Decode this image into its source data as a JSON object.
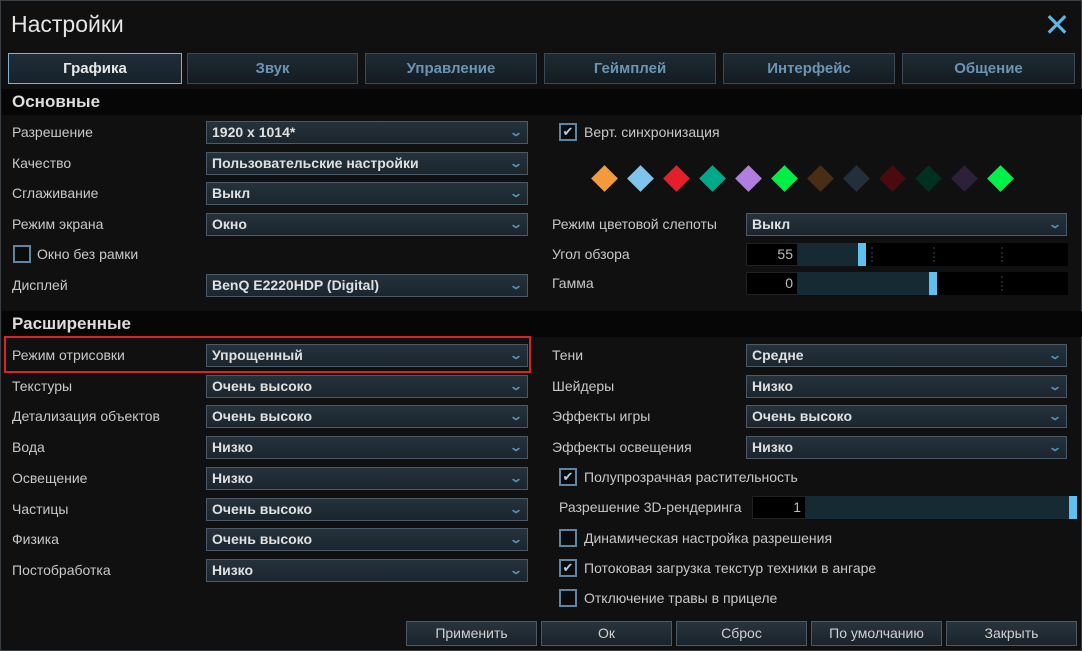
{
  "title": "Настройки",
  "tabs": [
    "Графика",
    "Звук",
    "Управление",
    "Геймплей",
    "Интерфейс",
    "Общение"
  ],
  "basic": {
    "header": "Основные",
    "resolution": {
      "label": "Разрешение",
      "value": "1920 x 1014*"
    },
    "quality": {
      "label": "Качество",
      "value": "Пользовательские настройки"
    },
    "aa": {
      "label": "Сглаживание",
      "value": "Выкл"
    },
    "screen_mode": {
      "label": "Режим экрана",
      "value": "Окно"
    },
    "borderless": {
      "label": "Окно без рамки",
      "checked": false
    },
    "display": {
      "label": "Дисплей",
      "value": "BenQ E2220HDP (Digital)"
    },
    "vsync": {
      "label": "Верт. синхронизация",
      "checked": true
    },
    "colors": [
      "#f39a3c",
      "#7fc4ec",
      "#e51f2a",
      "#00a98a",
      "#b07ee0",
      "#00ee45",
      "#4a2d15",
      "#22303b",
      "#4a0b0e",
      "#00301f",
      "#2d2038",
      "#00f04a"
    ],
    "colorblind": {
      "label": "Режим цветовой слепоты",
      "value": "Выкл"
    },
    "fov": {
      "label": "Угол обзора",
      "value": "55",
      "fraction": 0.23
    },
    "gamma": {
      "label": "Гамма",
      "value": "0",
      "fraction": 0.5
    }
  },
  "advanced": {
    "header": "Расширенные",
    "left": [
      {
        "label": "Режим отрисовки",
        "value": "Упрощенный"
      },
      {
        "label": "Текстуры",
        "value": "Очень высоко"
      },
      {
        "label": "Детализация объектов",
        "value": "Очень высоко"
      },
      {
        "label": "Вода",
        "value": "Низко"
      },
      {
        "label": "Освещение",
        "value": "Низко"
      },
      {
        "label": "Частицы",
        "value": "Очень высоко"
      },
      {
        "label": "Физика",
        "value": "Очень высоко"
      },
      {
        "label": "Постобработка",
        "value": "Низко"
      }
    ],
    "right": [
      {
        "label": "Тени",
        "value": "Средне"
      },
      {
        "label": "Шейдеры",
        "value": "Низко"
      },
      {
        "label": "Эффекты игры",
        "value": "Очень высоко"
      },
      {
        "label": "Эффекты освещения",
        "value": "Низко"
      }
    ],
    "translucent": {
      "label": "Полупрозрачная растительность",
      "checked": true
    },
    "render3d": {
      "label": "Разрешение 3D-рендеринга",
      "value": "1",
      "fraction": 1.0
    },
    "dynamic": {
      "label": "Динамическая настройка разрешения",
      "checked": false
    },
    "streaming": {
      "label": "Потоковая загрузка текстур техники в ангаре",
      "checked": true
    },
    "grass": {
      "label": "Отключение травы в прицеле",
      "checked": false
    }
  },
  "buttons": {
    "apply": "Применить",
    "ok": "Ок",
    "reset": "Сброс",
    "default": "По умолчанию",
    "close": "Закрыть"
  },
  "check_glyph": "✔",
  "chevron": "⌄",
  "close_glyph": "✕"
}
